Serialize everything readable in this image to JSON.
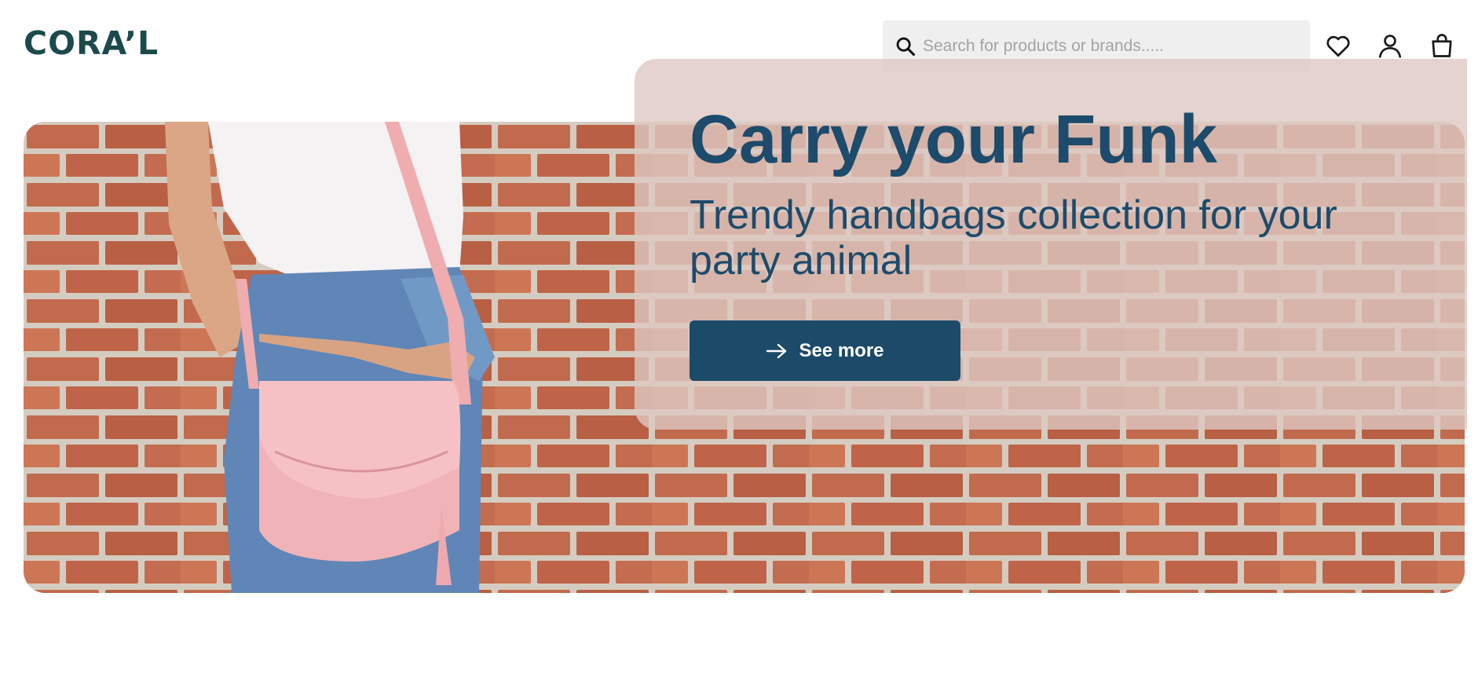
{
  "brand": {
    "logo_text": "CORA’L",
    "color": "#1b4a4d"
  },
  "header": {
    "search": {
      "placeholder": "Search for products or brands.....",
      "icon": "search-icon"
    },
    "icons": [
      "heart-icon",
      "user-icon",
      "shopping-bag-icon"
    ]
  },
  "hero": {
    "title": "Carry your Funk",
    "subtitle": "Trendy handbags collection for your party animal",
    "cta_label": "See more",
    "cta_icon": "arrow-right-icon",
    "colors": {
      "text": "#1d4b6b",
      "button": "#1c4b69",
      "panel": "#ddc8c2",
      "brick": "#c1694d",
      "bag": "#f2b7bb"
    }
  }
}
